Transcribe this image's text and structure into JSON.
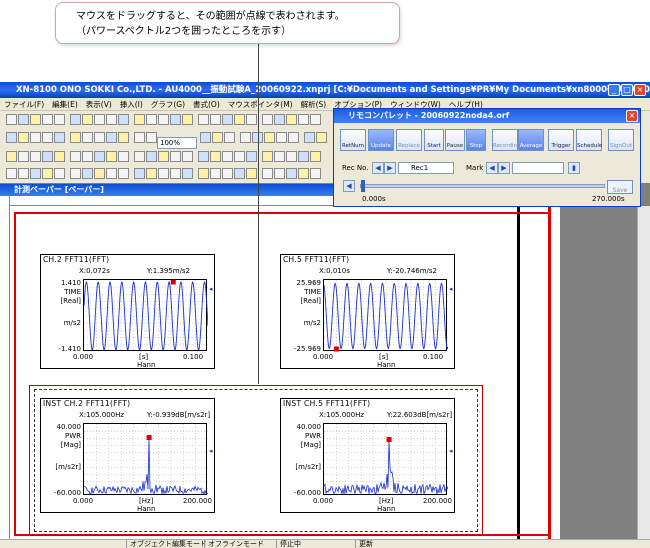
{
  "callout": {
    "line1": "マウスをドラッグすると、その範囲が点線で表わされます。",
    "line2": "（パワースペクトル2つを囲ったところを示す）"
  },
  "app": {
    "title": "XN-8100 ONO SOKKI Co.,LTD. - AU4000__振動試験A_20060922.xnprj [C:¥Documents and Settings¥PR¥My Documents¥xn8000¥AU4000__振..."
  },
  "menu": [
    "ファイル(F)",
    "編集(E)",
    "表示(V)",
    "挿入(I)",
    "グラフ(G)",
    "書式(O)",
    "マウスポインタ(M)",
    "解析(S)",
    "オプション(P)",
    "ウィンドウ(W)",
    "ヘルプ(H)"
  ],
  "toolbar": {
    "zoom_value": "100%"
  },
  "child_window": {
    "title": "計測ペーパー [ペーパー]"
  },
  "remote": {
    "title": "リモコンパレット - 20060922noda4.orf",
    "buttons": [
      "RetNum",
      "Update",
      "Replace",
      "Start",
      "Pause",
      "Stop",
      "Recording",
      "Average",
      "Trigger",
      "Schedule",
      "SignOut"
    ],
    "rec_label": "Rec No.",
    "rec_value": "Rec1",
    "mark_label": "Mark",
    "time_start": "0.000s",
    "time_end": "270.000s",
    "save_label": "Save"
  },
  "graphs": [
    {
      "title": "CH.2  FFT11(FFT)",
      "cursor_x": "X:0.072s",
      "cursor_y": "Y:1.395m/s2",
      "y_top": "1.410",
      "y_bottom": "-1.410",
      "y_label1": "TIME",
      "y_label2": "[Real]",
      "y_unit": "m/s2",
      "x_min": "0.000",
      "x_max": "0.100",
      "x_unit": "[s]",
      "x_window": "Hann"
    },
    {
      "title": "CH.5  FFT11(FFT)",
      "cursor_x": "X:0.010s",
      "cursor_y": "Y:-20.746m/s2",
      "y_top": "25.969",
      "y_bottom": "-25.969",
      "y_label1": "TIME",
      "y_label2": "[Real]",
      "y_unit": "m/s2",
      "x_min": "0.000",
      "x_max": "0.100",
      "x_unit": "[s]",
      "x_window": "Hann"
    },
    {
      "title": "INST  CH.2  FFT11(FFT)",
      "cursor_x": "X:105.000Hz",
      "cursor_y": "Y:-0.939dB[m/s2r]",
      "y_top": "40.000",
      "y_bottom": "-60.000",
      "y_label1": "PWR",
      "y_label2": "[Mag]",
      "y_unit": "[m/s2r]",
      "x_min": "0.000",
      "x_max": "200.000",
      "x_unit": "[Hz]",
      "x_window": "Hann"
    },
    {
      "title": "INST  CH.5  FFT11(FFT)",
      "cursor_x": "X:105.000Hz",
      "cursor_y": "Y:22.603dB[m/s2r]",
      "y_top": "40.000",
      "y_bottom": "-60.000",
      "y_label1": "PWR",
      "y_label2": "[Mag]",
      "y_unit": "[m/s2r]",
      "x_min": "0.000",
      "x_max": "200.000",
      "x_unit": "[Hz]",
      "x_window": "Hann"
    }
  ],
  "status": {
    "mode": "オブジェクト編集モード",
    "offline": "オフラインモード",
    "state": "停止中",
    "update": "更新"
  }
}
